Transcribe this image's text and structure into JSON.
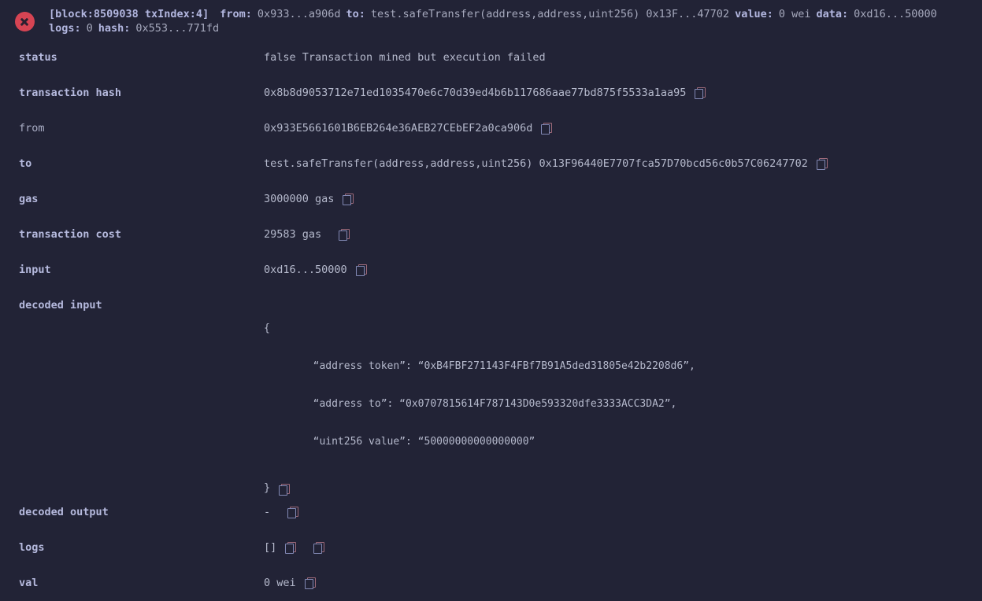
{
  "header": {
    "status_icon": "error-circle-x-icon",
    "block_label": "[block:8509038 txIndex:4]",
    "from_label": "from:",
    "from_value": "0x933...a906d",
    "to_label": "to:",
    "to_value": "test.safeTransfer(address,address,uint256) 0x13F...47702",
    "value_label": "value:",
    "value_value": "0 wei",
    "data_label": "data:",
    "data_value": "0xd16...50000",
    "logs_label": "logs:",
    "logs_value": "0",
    "hash_label": "hash:",
    "hash_value": "0x553...771fd"
  },
  "rows": {
    "status": {
      "label": "status",
      "value": "false Transaction mined but execution failed"
    },
    "transaction_hash": {
      "label": "transaction hash",
      "value": "0x8b8d9053712e71ed1035470e6c70d39ed4b6b117686aae77bd875f5533a1aa95"
    },
    "from": {
      "label": "from",
      "value": "0x933E5661601B6EB264e36AEB27CEbEF2a0ca906d"
    },
    "to": {
      "label": "to",
      "value": "test.safeTransfer(address,address,uint256) 0x13F96440E7707fca57D70bcd56c0b57C06247702"
    },
    "gas": {
      "label": "gas",
      "value": "3000000 gas"
    },
    "transaction_cost": {
      "label": "transaction cost",
      "value": "29583 gas"
    },
    "input": {
      "label": "input",
      "value": "0xd16...50000"
    },
    "decoded_input": {
      "label": "decoded input",
      "open_brace": "{",
      "line1": "        “address token”: “0xB4FBF271143F4FBf7B91A5ded31805e42b2208d6”,",
      "line2": "        “address to”: “0x0707815614F787143D0e593320dfe3333ACC3DA2”,",
      "line3": "        “uint256 value”: “50000000000000000”",
      "close_brace": "}"
    },
    "decoded_output": {
      "label": "decoded output",
      "value": "-"
    },
    "logs": {
      "label": "logs",
      "value": "[]"
    },
    "val": {
      "label": "val",
      "value": "0 wei"
    }
  },
  "icons": {
    "copy": "copy-icon"
  },
  "colors": {
    "background": "#222336",
    "label": "#b6bade",
    "value": "#b5b9cc",
    "error": "#d64453",
    "copy_back": "#9e6a7a",
    "copy_front": "#8289b5"
  }
}
